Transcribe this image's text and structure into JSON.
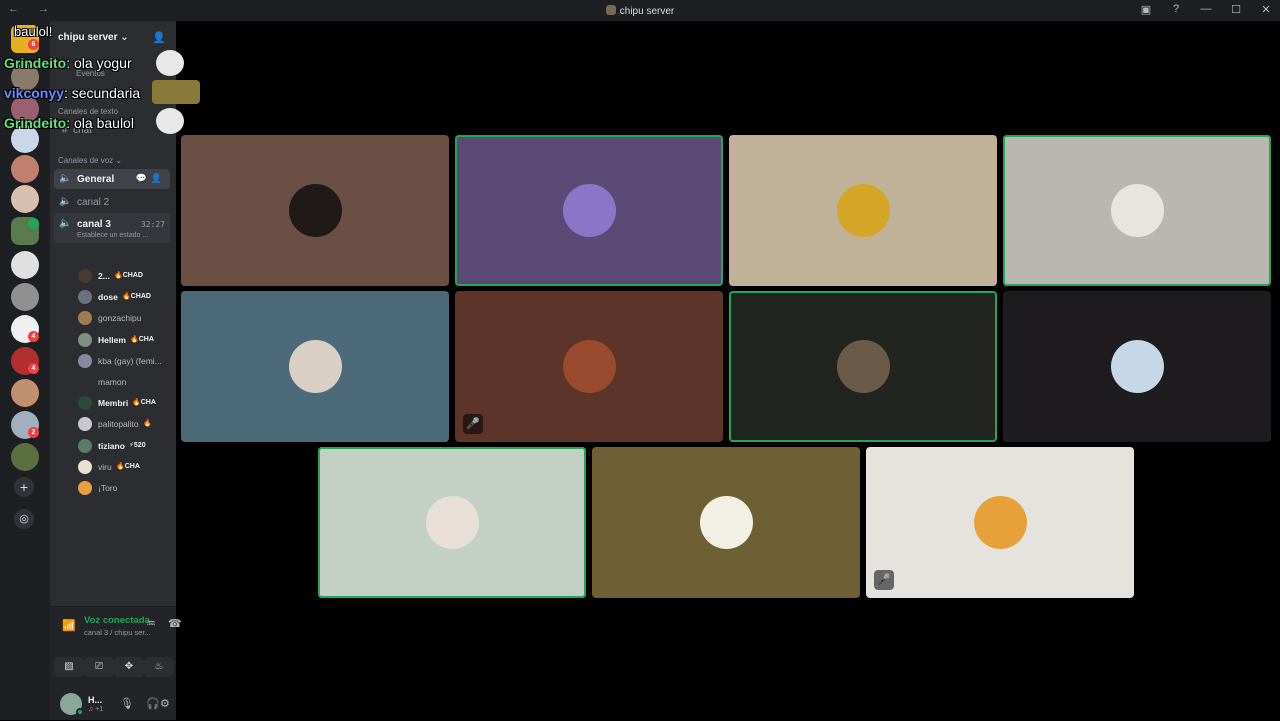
{
  "window": {
    "title": "chipu server",
    "nav_glyphs": "← →",
    "controls": [
      "▣",
      "?",
      "—",
      "☐",
      "✕"
    ]
  },
  "rail": {
    "badges": [
      "6",
      "4",
      "4",
      "2"
    ],
    "add_glyph": "+",
    "explore_glyph": "◎"
  },
  "server": {
    "name": "chipu server",
    "name_chevron": "⌄"
  },
  "channels": {
    "events_label": "Eventos",
    "text_category": "Canales de texto",
    "text_channel": "chat",
    "voice_category": "Canales de voz ⌄",
    "voice_channels": [
      {
        "label": "General"
      },
      {
        "label": "canal 2"
      }
    ],
    "active_voice": {
      "label": "canal 3",
      "time": "32:27",
      "status": "Establece un estado ..."
    }
  },
  "members": [
    {
      "name": "2...",
      "tag": "🔥CHAD",
      "bold": true,
      "color": "#4b3a30"
    },
    {
      "name": "dose",
      "tag": "🔥CHAD",
      "bold": true,
      "color": "#6a7282"
    },
    {
      "name": "gonzachipu",
      "tag": "",
      "bold": false,
      "color": "#a07c52"
    },
    {
      "name": "Hellem",
      "tag": "🔥CHA",
      "bold": true,
      "color": "#7e9080"
    },
    {
      "name": "kba (gay) (femi...",
      "tag": "",
      "bold": false,
      "color": "#8888a0"
    },
    {
      "name": "mamon",
      "tag": "",
      "bold": false,
      "color": "#2b2d31"
    },
    {
      "name": "Membri",
      "tag": "🔥CHA",
      "bold": true,
      "color": "#2a4a3a"
    },
    {
      "name": "palitopalito",
      "tag": "🔥",
      "bold": false,
      "color": "#c8c8d0"
    },
    {
      "name": "tiziano",
      "tag": "⚡520",
      "bold": true,
      "color": "#5a7a6a"
    },
    {
      "name": "viru",
      "tag": "🔥CHA",
      "bold": false,
      "color": "#e8e0d0"
    },
    {
      "name": "¡Toro",
      "tag": "",
      "bold": false,
      "color": "#e8a040"
    }
  ],
  "voice_panel": {
    "title": "Voz conectada",
    "subtitle": "canal 3 / chipu ser...",
    "buttons": [
      "▨",
      "⎚",
      "✥",
      "♨"
    ]
  },
  "user": {
    "name": "H...",
    "status": "♫ +1"
  },
  "chat_overlay": [
    {
      "user": "Grindeito",
      "text": ": ola yogur",
      "color": "#5fe07a"
    },
    {
      "user": "vikconyy",
      "text": ": secundaria",
      "color": "#6b8cff"
    },
    {
      "user": "Grindeito",
      "text": ": ola baulol",
      "color": "#5fe07a"
    }
  ],
  "overlay_fragment": "baulol!",
  "tiles": [
    {
      "bg": "#6b4f45",
      "avatar": "#1f1a18",
      "speaking": false,
      "muted": false
    },
    {
      "bg": "#5c4a76",
      "avatar": "#8a76c8",
      "speaking": true,
      "muted": false
    },
    {
      "bg": "#bfb298",
      "avatar": "#d4a628",
      "speaking": false,
      "muted": false
    },
    {
      "bg": "#bab7b2",
      "avatar": "#e8e4e0",
      "speaking": true,
      "muted": false
    },
    {
      "bg": "#4c6a79",
      "avatar": "#d9cfc4",
      "speaking": false,
      "muted": false
    },
    {
      "bg": "#5d342a",
      "avatar": "#9a4a2e",
      "speaking": false,
      "muted": true
    },
    {
      "bg": "#222420",
      "avatar": "#6b5a4a",
      "speaking": true,
      "muted": false
    },
    {
      "bg": "#1f1c20",
      "avatar": "#c6d8e8",
      "speaking": false,
      "muted": false
    },
    {
      "bg": "#c4d0c6",
      "avatar": "#e8e0d8",
      "speaking": true,
      "muted": false
    },
    {
      "bg": "#6f5f35",
      "avatar": "#f2efe4",
      "speaking": false,
      "muted": false
    },
    {
      "bg": "#e6e3de",
      "avatar": "#e7a13a",
      "speaking": false,
      "muted": true
    }
  ]
}
